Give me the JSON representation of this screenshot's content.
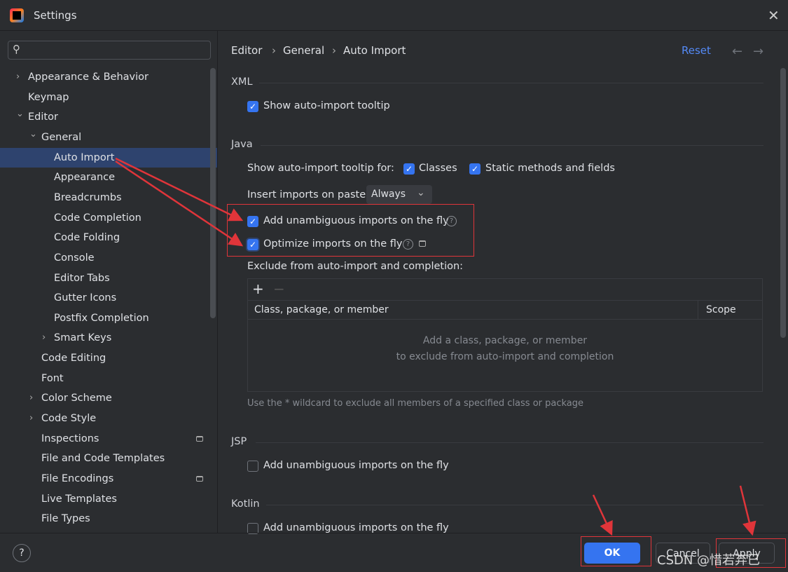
{
  "window": {
    "title": "Settings",
    "close_icon": "close-icon"
  },
  "sidebar": {
    "items": [
      {
        "label": "Appearance & Behavior",
        "level": 0,
        "expander": "collapsed"
      },
      {
        "label": "Keymap",
        "level": 0
      },
      {
        "label": "Editor",
        "level": 0,
        "expander": "expanded"
      },
      {
        "label": "General",
        "level": 1,
        "expander": "expanded"
      },
      {
        "label": "Auto Import",
        "level": 2,
        "selected": true
      },
      {
        "label": "Appearance",
        "level": 2
      },
      {
        "label": "Breadcrumbs",
        "level": 2
      },
      {
        "label": "Code Completion",
        "level": 2
      },
      {
        "label": "Code Folding",
        "level": 2
      },
      {
        "label": "Console",
        "level": 2
      },
      {
        "label": "Editor Tabs",
        "level": 2
      },
      {
        "label": "Gutter Icons",
        "level": 2
      },
      {
        "label": "Postfix Completion",
        "level": 2
      },
      {
        "label": "Smart Keys",
        "level": 2,
        "expander": "collapsed"
      },
      {
        "label": "Code Editing",
        "level": 1
      },
      {
        "label": "Font",
        "level": 1
      },
      {
        "label": "Color Scheme",
        "level": 1,
        "expander": "collapsed"
      },
      {
        "label": "Code Style",
        "level": 1,
        "expander": "collapsed"
      },
      {
        "label": "Inspections",
        "level": 1,
        "badge": true
      },
      {
        "label": "File and Code Templates",
        "level": 1
      },
      {
        "label": "File Encodings",
        "level": 1,
        "badge": true
      },
      {
        "label": "Live Templates",
        "level": 1
      },
      {
        "label": "File Types",
        "level": 1
      }
    ]
  },
  "breadcrumb": [
    "Editor",
    "General",
    "Auto Import"
  ],
  "header": {
    "reset": "Reset"
  },
  "xml": {
    "title": "XML",
    "show_tooltip": "Show auto-import tooltip"
  },
  "java": {
    "title": "Java",
    "tooltip_for": "Show auto-import tooltip for:",
    "classes": "Classes",
    "static": "Static methods and fields",
    "insert_label": "Insert imports on paste:",
    "insert_value": "Always",
    "add_unambiguous": "Add unambiguous imports on the fly",
    "optimize": "Optimize imports on the fly",
    "exclude_label": "Exclude from auto-import and completion:",
    "col_class": "Class, package, or member",
    "col_scope": "Scope",
    "empty1": "Add a class, package, or member",
    "empty2": "to exclude from auto-import and completion",
    "hint": "Use the * wildcard to exclude all members of a specified class or package"
  },
  "jsp": {
    "title": "JSP",
    "add_unambiguous": "Add unambiguous imports on the fly"
  },
  "kotlin": {
    "title": "Kotlin",
    "add_unambiguous": "Add unambiguous imports on the fly"
  },
  "buttons": {
    "ok": "OK",
    "cancel": "Cancel",
    "apply": "Apply",
    "help": "?"
  },
  "watermark": "CSDN @惜若弃已",
  "colors": {
    "accent": "#3574f0",
    "annotation": "#e0353a",
    "link": "#548af7"
  }
}
